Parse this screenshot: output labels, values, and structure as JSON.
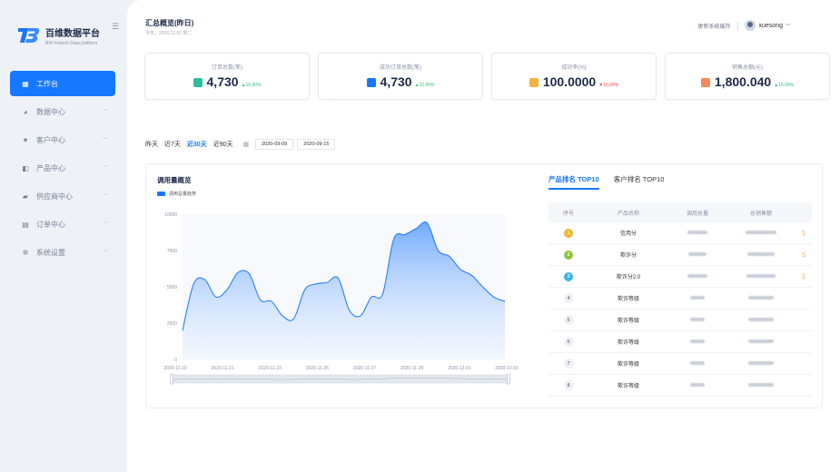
{
  "app": {
    "title": "百维数据平台",
    "subtitle": "BW Fintech Data platform"
  },
  "sidebar": {
    "items": [
      {
        "label": "工作台",
        "icon": "dashboard-icon",
        "glyph": "▦",
        "active": true
      },
      {
        "label": "数据中心",
        "icon": "data-icon",
        "glyph": "◕",
        "active": false
      },
      {
        "label": "客户中心",
        "icon": "customer-icon",
        "glyph": "♥",
        "active": false
      },
      {
        "label": "产品中心",
        "icon": "product-icon",
        "glyph": "◧",
        "active": false
      },
      {
        "label": "供应商中心",
        "icon": "supplier-icon",
        "glyph": "▰",
        "active": false
      },
      {
        "label": "订单中心",
        "icon": "order-icon",
        "glyph": "▤",
        "active": false
      },
      {
        "label": "系统设置",
        "icon": "settings-icon",
        "glyph": "✲",
        "active": false
      }
    ]
  },
  "header": {
    "title": "汇总概览(昨日)",
    "date": "今天，2020.12.01 周二",
    "link": "更新系统缓存",
    "user": "xuesong"
  },
  "kpis": [
    {
      "label": "订单总数(笔)",
      "value": "4,730",
      "change": "10.00%",
      "direction": "up",
      "arrow": "▲",
      "color": "#2bbf9b"
    },
    {
      "label": "成功订单总数(笔)",
      "value": "4,730",
      "change": "10.00%",
      "direction": "up",
      "arrow": "▲",
      "color": "#1677ff"
    },
    {
      "label": "成功率(%)",
      "value": "100.0000",
      "change": "10.00%",
      "direction": "down",
      "arrow": "▼",
      "color": "#f6b33d"
    },
    {
      "label": "销售总额(元)",
      "value": "1,800.040",
      "change": "10.00%",
      "direction": "up",
      "arrow": "▲",
      "color": "#f58a5a"
    }
  ],
  "filters": {
    "ranges": [
      {
        "label": "昨天",
        "active": false
      },
      {
        "label": "近7天",
        "active": false
      },
      {
        "label": "近30天",
        "active": true
      },
      {
        "label": "近90天",
        "active": false
      }
    ],
    "start": "2020-09-09",
    "end": "2020-09-15"
  },
  "chart": {
    "title": "调用量概览",
    "legend": "调用总量趋势"
  },
  "chart_data": {
    "type": "area",
    "series": [
      {
        "name": "调用总量趋势",
        "values": [
          2000,
          5200,
          5500,
          4300,
          4800,
          6000,
          5900,
          4100,
          4000,
          3000,
          2800,
          4800,
          5200,
          5300,
          5600,
          3400,
          3000,
          4300,
          4500,
          8300,
          8600,
          9000,
          9400,
          7500,
          7100,
          6200,
          5800,
          5000,
          4300,
          4000
        ]
      }
    ],
    "xticks": [
      "2020-11-19",
      "2020-11-21",
      "2020-11-23",
      "2020-11-25",
      "2020-11-27",
      "2020-11-29",
      "2020-12-01",
      "2020-12-03"
    ],
    "yticks": [
      "0",
      "2500",
      "5000",
      "7500",
      "10000"
    ],
    "ylim": [
      0,
      10000
    ],
    "color": "#1677ff"
  },
  "ranking": {
    "tabs": [
      {
        "label": "产品排名 TOP10",
        "active": true
      },
      {
        "label": "客户排名 TOP10",
        "active": false
      }
    ],
    "columns": [
      "序号",
      "产品名称",
      "调用总量",
      "总销售额"
    ],
    "rows": [
      {
        "rank": "1",
        "medal": "#f2b431",
        "name": "信用分",
        "coin": true
      },
      {
        "rank": "2",
        "medal": "#8cc63f",
        "name": "欺诈分",
        "coin": true
      },
      {
        "rank": "3",
        "medal": "#3ab4e6",
        "name": "欺诈分2.0",
        "coin": true
      },
      {
        "rank": "4",
        "medal": "",
        "name": "欺诈等级",
        "coin": false
      },
      {
        "rank": "5",
        "medal": "",
        "name": "欺诈等级",
        "coin": false
      },
      {
        "rank": "6",
        "medal": "",
        "name": "欺诈等级",
        "coin": false
      },
      {
        "rank": "7",
        "medal": "",
        "name": "欺诈等级",
        "coin": false
      },
      {
        "rank": "8",
        "medal": "",
        "name": "欺诈等级",
        "coin": false
      }
    ]
  }
}
